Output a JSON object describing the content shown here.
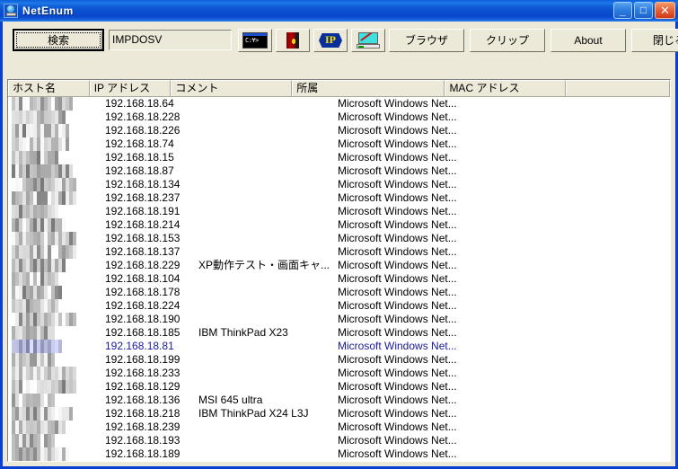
{
  "window": {
    "title": "NetEnum",
    "icon": "network-computer-icon",
    "minimize_label": "_",
    "maximize_label": "□",
    "close_label": "✕"
  },
  "toolbar": {
    "search_button_label": "検索",
    "search_value": "IMPDOSV",
    "icon_buttons": [
      {
        "name": "command-prompt-icon",
        "glyph": "C:¥>"
      },
      {
        "name": "door-exit-icon",
        "glyph": ""
      },
      {
        "name": "ip-badge-icon",
        "glyph": "IP"
      },
      {
        "name": "monitor-chart-icon",
        "glyph": ""
      }
    ],
    "browser_label": "ブラウザ",
    "clip_label": "クリップ",
    "about_label": "About",
    "close_label": "閉じる"
  },
  "list": {
    "columns": [
      {
        "key": "host",
        "label": "ホスト名"
      },
      {
        "key": "ip",
        "label": "IP アドレス"
      },
      {
        "key": "comment",
        "label": "コメント"
      },
      {
        "key": "group",
        "label": "所属"
      },
      {
        "key": "mac",
        "label": "MAC アドレス"
      },
      {
        "key": "pad",
        "label": ""
      }
    ],
    "rows": [
      {
        "host": "IMPDOSVNT3",
        "host_redacted": true,
        "ip": "192.168.18.64",
        "comment": "",
        "group": "Microsoft Windows Net...",
        "mac": "",
        "selected": false
      },
      {
        "host": "",
        "host_redacted": true,
        "ip": "192.168.18.228",
        "comment": "",
        "group": "Microsoft Windows Net...",
        "mac": "",
        "selected": false
      },
      {
        "host": "",
        "host_redacted": true,
        "ip": "192.168.18.226",
        "comment": "",
        "group": "Microsoft Windows Net...",
        "mac": "",
        "selected": false
      },
      {
        "host": "",
        "host_redacted": true,
        "ip": "192.168.18.74",
        "comment": "",
        "group": "Microsoft Windows Net...",
        "mac": "",
        "selected": false
      },
      {
        "host": "",
        "host_redacted": true,
        "ip": "192.168.18.15",
        "comment": "",
        "group": "Microsoft Windows Net...",
        "mac": "",
        "selected": false
      },
      {
        "host": "",
        "host_redacted": true,
        "ip": "192.168.18.87",
        "comment": "",
        "group": "Microsoft Windows Net...",
        "mac": "",
        "selected": false
      },
      {
        "host": "",
        "host_redacted": true,
        "ip": "192.168.18.134",
        "comment": "",
        "group": "Microsoft Windows Net...",
        "mac": "",
        "selected": false
      },
      {
        "host": "",
        "host_redacted": true,
        "ip": "192.168.18.237",
        "comment": "",
        "group": "Microsoft Windows Net...",
        "mac": "",
        "selected": false
      },
      {
        "host": "",
        "host_redacted": true,
        "ip": "192.168.18.191",
        "comment": "",
        "group": "Microsoft Windows Net...",
        "mac": "",
        "selected": false
      },
      {
        "host": "",
        "host_redacted": true,
        "ip": "192.168.18.214",
        "comment": "",
        "group": "Microsoft Windows Net...",
        "mac": "",
        "selected": false
      },
      {
        "host": "",
        "host_redacted": true,
        "ip": "192.168.18.153",
        "comment": "",
        "group": "Microsoft Windows Net...",
        "mac": "",
        "selected": false
      },
      {
        "host": "",
        "host_redacted": true,
        "ip": "192.168.18.137",
        "comment": "",
        "group": "Microsoft Windows Net...",
        "mac": "",
        "selected": false
      },
      {
        "host": "",
        "host_redacted": true,
        "ip": "192.168.18.229",
        "comment": "XP動作テスト・画面キャ...",
        "group": "Microsoft Windows Net...",
        "mac": "",
        "selected": false
      },
      {
        "host": "",
        "host_redacted": true,
        "ip": "192.168.18.104",
        "comment": "",
        "group": "Microsoft Windows Net...",
        "mac": "",
        "selected": false
      },
      {
        "host": "",
        "host_redacted": true,
        "ip": "192.168.18.178",
        "comment": "",
        "group": "Microsoft Windows Net...",
        "mac": "",
        "selected": false
      },
      {
        "host": "",
        "host_redacted": true,
        "ip": "192.168.18.224",
        "comment": "",
        "group": "Microsoft Windows Net...",
        "mac": "",
        "selected": false
      },
      {
        "host": "",
        "host_redacted": true,
        "ip": "192.168.18.190",
        "comment": "",
        "group": "Microsoft Windows Net...",
        "mac": "",
        "selected": false
      },
      {
        "host": "",
        "host_redacted": true,
        "ip": "192.168.18.185",
        "comment": "IBM ThinkPad X23",
        "group": "Microsoft Windows Net...",
        "mac": "",
        "selected": false
      },
      {
        "host": "",
        "host_redacted": true,
        "ip": "192.168.18.81",
        "comment": "",
        "group": "Microsoft Windows Net...",
        "mac": "",
        "selected": true
      },
      {
        "host": "",
        "host_redacted": true,
        "ip": "192.168.18.199",
        "comment": "",
        "group": "Microsoft Windows Net...",
        "mac": "",
        "selected": false
      },
      {
        "host": "",
        "host_redacted": true,
        "ip": "192.168.18.233",
        "comment": "",
        "group": "Microsoft Windows Net...",
        "mac": "",
        "selected": false
      },
      {
        "host": "",
        "host_redacted": true,
        "ip": "192.168.18.129",
        "comment": "",
        "group": "Microsoft Windows Net...",
        "mac": "",
        "selected": false
      },
      {
        "host": "",
        "host_redacted": true,
        "ip": "192.168.18.136",
        "comment": "MSI 645 ultra",
        "group": "Microsoft Windows Net...",
        "mac": "",
        "selected": false
      },
      {
        "host": "",
        "host_redacted": true,
        "ip": "192.168.18.218",
        "comment": "IBM ThinkPad X24 L3J",
        "group": "Microsoft Windows Net...",
        "mac": "",
        "selected": false
      },
      {
        "host": "",
        "host_redacted": true,
        "ip": "192.168.18.239",
        "comment": "",
        "group": "Microsoft Windows Net...",
        "mac": "",
        "selected": false
      },
      {
        "host": "",
        "host_redacted": true,
        "ip": "192.168.18.193",
        "comment": "",
        "group": "Microsoft Windows Net...",
        "mac": "",
        "selected": false
      },
      {
        "host": "",
        "host_redacted": true,
        "ip": "192.168.18.189",
        "comment": "",
        "group": "Microsoft Windows Net...",
        "mac": "",
        "selected": false
      }
    ]
  },
  "colors": {
    "titlebar_blue": "#0a4fd0",
    "window_frame": "#0a3fd4",
    "face": "#ece9d8",
    "selected_text": "#17189c",
    "close_button": "#cc3a18"
  }
}
